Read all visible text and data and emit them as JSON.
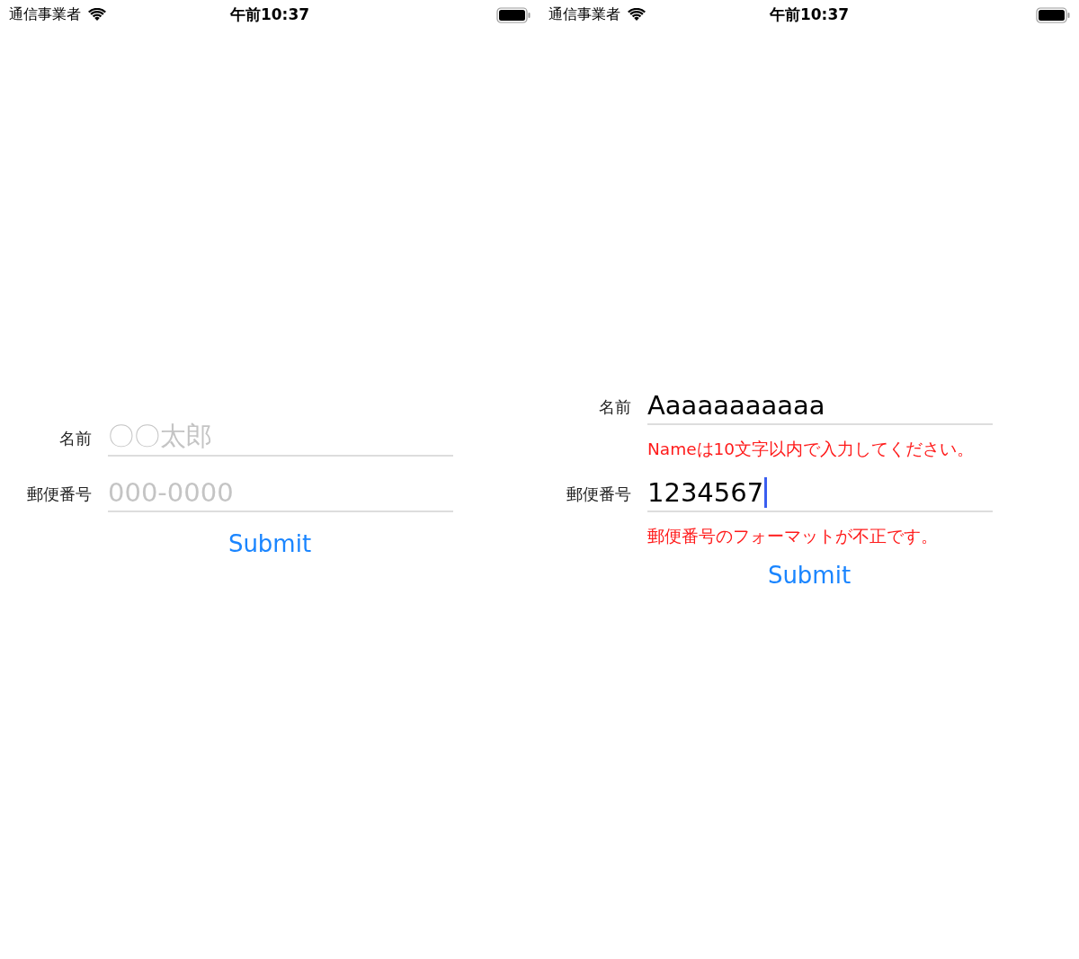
{
  "screens": [
    {
      "status_bar": {
        "carrier": "通信事業者",
        "time": "午前10:37"
      },
      "fields": [
        {
          "label": "名前",
          "placeholder": "〇〇太郎",
          "focused": false
        },
        {
          "label": "郵便番号",
          "placeholder": "000-0000",
          "focused": false
        }
      ],
      "submit": "Submit"
    },
    {
      "status_bar": {
        "carrier": "通信事業者",
        "time": "午前10:37"
      },
      "fields": [
        {
          "label": "名前",
          "value": "Aaaaaaaaaaa",
          "focused": false,
          "error": "Nameは10文字以内で入力してください。"
        },
        {
          "label": "郵便番号",
          "value": "1234567",
          "focused": true,
          "error": "郵便番号のフォーマットが不正です。"
        }
      ],
      "submit": "Submit"
    }
  ]
}
